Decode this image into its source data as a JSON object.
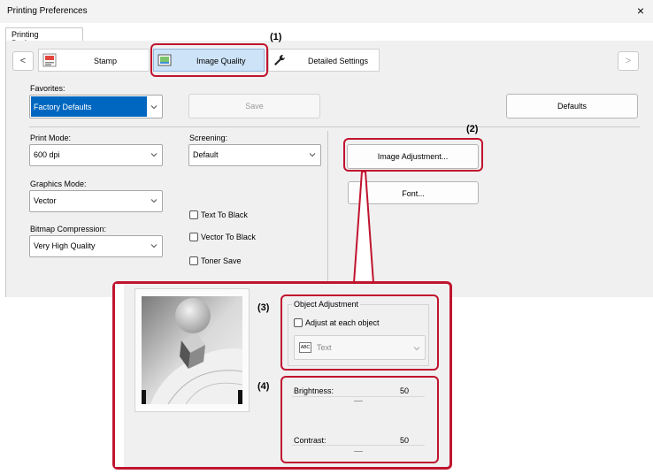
{
  "window": {
    "title": "Printing Preferences",
    "close_glyph": "×"
  },
  "tab_main": "Printing Preferences",
  "nav": {
    "prev": "<",
    "next": ">",
    "tabs": [
      {
        "label": "Stamp",
        "icon": "stamp-icon"
      },
      {
        "label": "Image Quality",
        "icon": "image-quality-icon"
      },
      {
        "label": "Detailed Settings",
        "icon": "wrench-icon"
      }
    ]
  },
  "favorites": {
    "label": "Favorites:",
    "value": "Factory Defaults",
    "save_label": "Save",
    "defaults_label": "Defaults"
  },
  "print_mode": {
    "label": "Print Mode:",
    "value": "600 dpi"
  },
  "screening": {
    "label": "Screening:",
    "value": "Default"
  },
  "graphics_mode": {
    "label": "Graphics Mode:",
    "value": "Vector"
  },
  "bitmap_compression": {
    "label": "Bitmap Compression:",
    "value": "Very High Quality"
  },
  "checkboxes": {
    "text_to_black": "Text To Black",
    "vector_to_black": "Vector To Black",
    "toner_save": "Toner Save"
  },
  "buttons": {
    "image_adjustment": "Image Adjustment...",
    "font": "Font..."
  },
  "callouts": {
    "c1": "(1)",
    "c2": "(2)",
    "c3": "(3)",
    "c4": "(4)"
  },
  "inset": {
    "object_adjustment": {
      "group_label": "Object Adjustment",
      "adjust_each": "Adjust at each object",
      "combo_icon_text": "ABC",
      "combo_value": "Text"
    },
    "brightness": {
      "label": "Brightness:",
      "value": "50"
    },
    "contrast": {
      "label": "Contrast:",
      "value": "50"
    }
  },
  "colors": {
    "accent_selected": "#0067c0",
    "callout_red": "#c0142e"
  }
}
